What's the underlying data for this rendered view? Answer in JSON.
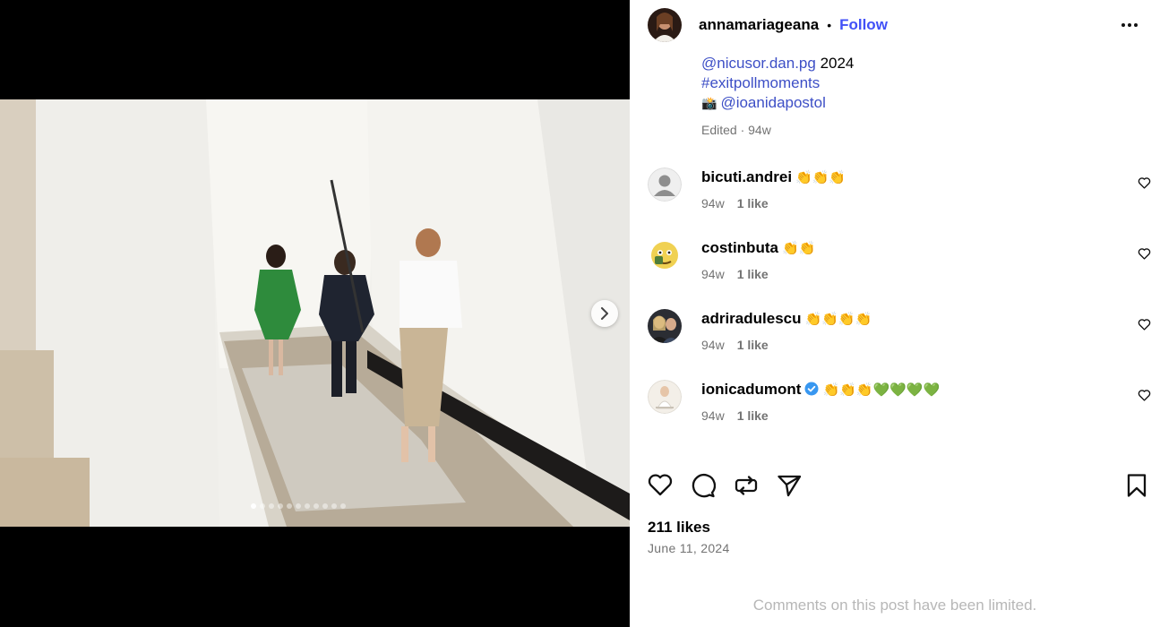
{
  "post": {
    "username": "annamariageana",
    "separator": "•",
    "follow_label": "Follow",
    "caption": {
      "mention_1": "@nicusor.dan.pg",
      "after_mention": " 2024",
      "hashtag": "#exitpollmoments",
      "camera_emoji": "📸",
      "mention_2": "@ioanidapostol",
      "meta": "Edited · 94w"
    },
    "carousel": {
      "slide_count": 11,
      "active_index": 0
    }
  },
  "comments": [
    {
      "user": "bicuti.andrei",
      "text": "👏👏👏",
      "age": "94w",
      "likes": "1 like",
      "verified": false
    },
    {
      "user": "costinbuta",
      "text": "👏👏",
      "age": "94w",
      "likes": "1 like",
      "verified": false
    },
    {
      "user": "adriradulescu",
      "text": "👏👏👏👏",
      "age": "94w",
      "likes": "1 like",
      "verified": false
    },
    {
      "user": "ionicadumont",
      "text": "👏👏👏💚💚💚💚",
      "age": "94w",
      "likes": "1 like",
      "verified": true
    }
  ],
  "footer": {
    "likes": "211 likes",
    "date": "June 11, 2024",
    "limited_notice": "Comments on this post have been limited."
  },
  "colors": {
    "link": "#3d4fc6",
    "follow": "#4150f7",
    "muted": "#737373",
    "verified": "#3897f0"
  }
}
